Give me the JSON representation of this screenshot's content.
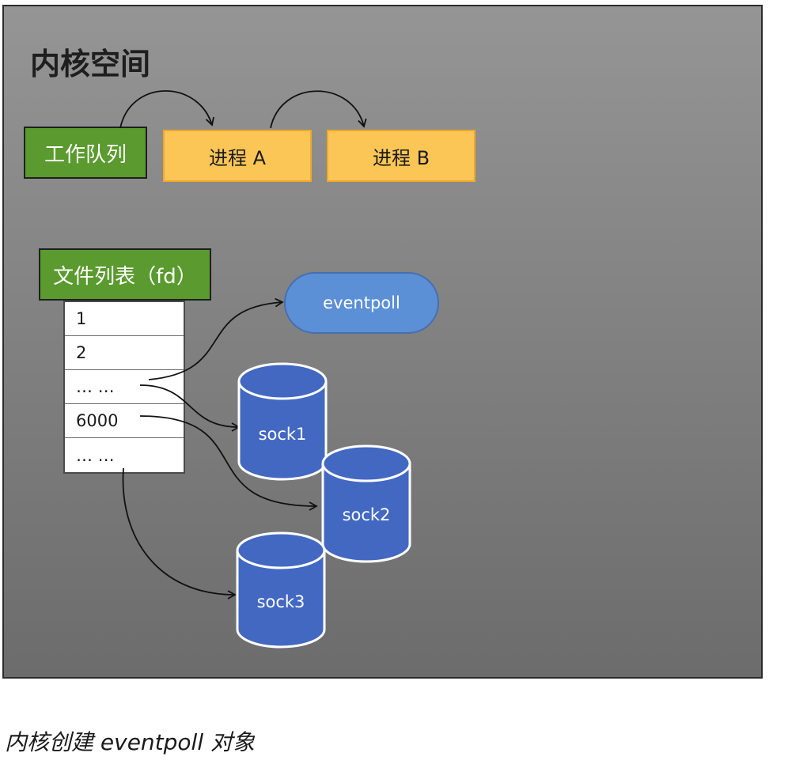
{
  "title": "内核空间",
  "work_queue": "工作队列",
  "process_a": "进程 A",
  "process_b": "进程 B",
  "fd_list_label": "文件列表（fd）",
  "fd_rows": [
    "1",
    "2",
    "… …",
    "6000",
    "… …"
  ],
  "eventpoll": "eventpoll",
  "socks": [
    "sock1",
    "sock2",
    "sock3"
  ],
  "caption": "内核创建 eventpoll 对象",
  "colors": {
    "panel_top": "#959595",
    "panel_bottom": "#6c6c6c",
    "green": "#5a9a2e",
    "yellow": "#fbc656",
    "eventpoll_blue": "#5b8fd6",
    "sock_blue": "#4268c1"
  }
}
